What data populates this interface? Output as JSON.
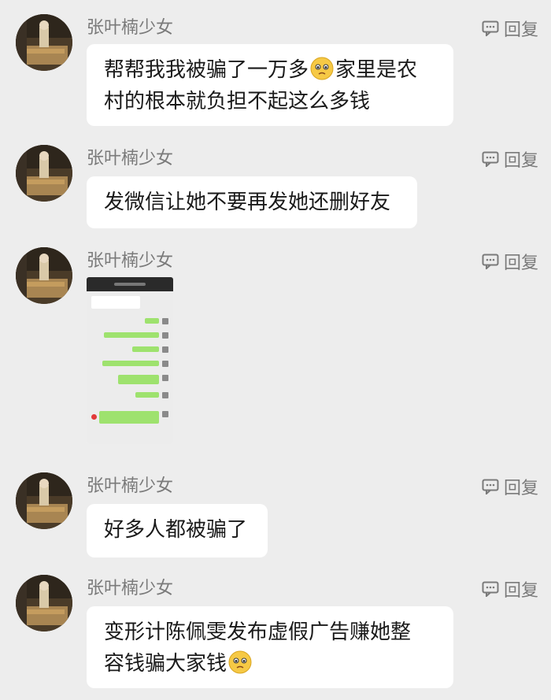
{
  "comments": [
    {
      "username": "张叶楠少女",
      "reply_label": "回复",
      "line1": "帮帮我我被骗了一万多",
      "line1_after_emoji": "家里是农",
      "line2": "村的根本就负担不起这么多钱"
    },
    {
      "username": "张叶楠少女",
      "reply_label": "回复",
      "text": "发微信让她不要再发她还删好友"
    },
    {
      "username": "张叶楠少女",
      "reply_label": "回复",
      "attachment": "chat-screenshot-image"
    },
    {
      "username": "张叶楠少女",
      "reply_label": "回复",
      "text": "好多人都被骗了"
    },
    {
      "username": "张叶楠少女",
      "reply_label": "回复",
      "line1": "变形计陈佩雯发布虚假广告赚她整",
      "line2": "容钱骗大家钱"
    }
  ],
  "icons": {
    "reply": "comment-icon",
    "emoji": "sad-face-emoji"
  }
}
